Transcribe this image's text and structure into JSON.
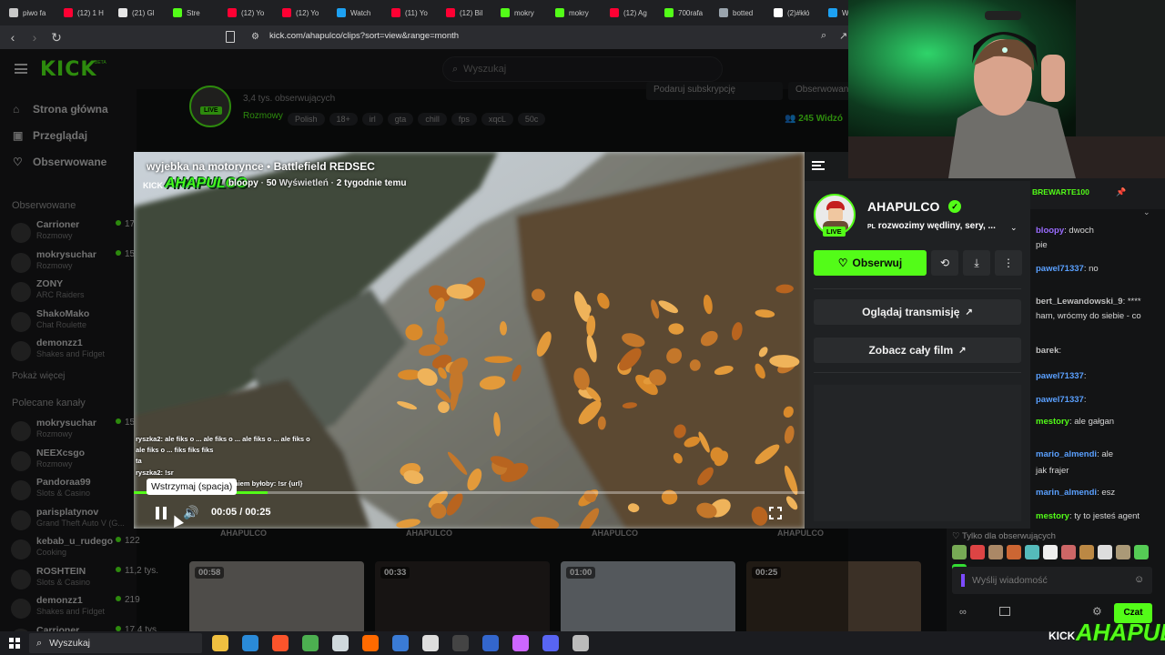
{
  "browser": {
    "tabs": [
      {
        "label": "piwo fa",
        "color": "#c9c9c9"
      },
      {
        "label": "(12) 1 H",
        "color": "#ff0033"
      },
      {
        "label": "(21) Gl",
        "color": "#e6e6e6"
      },
      {
        "label": "Stre",
        "color": "#53fc18"
      },
      {
        "label": "(12) Yo",
        "color": "#ff0033"
      },
      {
        "label": "(12) Yo",
        "color": "#ff0033"
      },
      {
        "label": "Watch",
        "color": "#1da1f2"
      },
      {
        "label": "(11) Yo",
        "color": "#ff0033"
      },
      {
        "label": "(12) Bil",
        "color": "#ff0033"
      },
      {
        "label": "mokry",
        "color": "#53fc18"
      },
      {
        "label": "mokry",
        "color": "#53fc18"
      },
      {
        "label": "(12) Ag",
        "color": "#ff0033"
      },
      {
        "label": "700rafa",
        "color": "#53fc18"
      },
      {
        "label": "botted",
        "color": "#9aa4ad"
      },
      {
        "label": "(2)#kłó",
        "color": "#ffffff"
      },
      {
        "label": "W",
        "color": "#1da1f2"
      }
    ],
    "url": "kick.com/ahapulco/clips?sort=view&range=month"
  },
  "kick": {
    "logo": "KICK",
    "logo_badge": "BETA",
    "search_placeholder": "Wyszukaj",
    "nav": [
      {
        "label": "Strona główna",
        "icon": "home-icon"
      },
      {
        "label": "Przeglądaj",
        "icon": "browse-icon"
      },
      {
        "label": "Obserwowane",
        "icon": "heart-icon"
      }
    ],
    "followed_header": "Obserwowane",
    "followed": [
      {
        "name": "Carrioner",
        "category": "Rozmowy",
        "viewers": "17,"
      },
      {
        "name": "mokrysuchar",
        "category": "Rozmowy",
        "viewers": "15,"
      },
      {
        "name": "ZONY",
        "category": "ARC Raiders",
        "viewers": ""
      },
      {
        "name": "ShakoMako",
        "category": "Chat Roulette",
        "viewers": ""
      },
      {
        "name": "demonzz1",
        "category": "Shakes and Fidget",
        "viewers": ""
      }
    ],
    "show_more": "Pokaż więcej",
    "recommended_header": "Polecane kanały",
    "recommended": [
      {
        "name": "mokrysuchar",
        "category": "Rozmowy",
        "viewers": "15,"
      },
      {
        "name": "NEEXcsgo",
        "category": "Rozmowy",
        "viewers": ""
      },
      {
        "name": "Pandoraa99",
        "category": "Slots & Casino",
        "viewers": ""
      },
      {
        "name": "parisplatynov",
        "category": "Grand Theft Auto V (G...",
        "viewers": ""
      },
      {
        "name": "kebab_u_rudego",
        "category": "Cooking",
        "viewers": "122"
      },
      {
        "name": "ROSHTEIN",
        "category": "Slots & Casino",
        "viewers": "11,2 tys."
      },
      {
        "name": "demonzz1",
        "category": "Shakes and Fidget",
        "viewers": "219"
      },
      {
        "name": "Carrioner",
        "category": "",
        "viewers": "17,4 tys."
      }
    ],
    "channel_header": {
      "followers": "3,4 tys. obserwujących",
      "category": "Rozmowy",
      "tags": [
        "Polish",
        "18+",
        "irl",
        "gta",
        "chill",
        "fps",
        "xqcL",
        "50c"
      ],
      "live": "LIVE",
      "viewers": "245 Widzó",
      "btn1": "Podaruj subskrypcję",
      "btn2": "Obserwowane"
    },
    "clip_channels": [
      "AHAPULCO",
      "AHAPULCO",
      "AHAPULCO",
      "AHAPULCO"
    ],
    "thumbnails": [
      {
        "duration": "00:58",
        "color": "#8e8a86"
      },
      {
        "duration": "00:33",
        "color": "#2a2623"
      },
      {
        "duration": "01:00",
        "color": "#9aa1a8"
      },
      {
        "duration": "00:25",
        "color": "#3b3026"
      }
    ]
  },
  "clip": {
    "title": "wyjebka na motorynce • Battlefield REDSEC",
    "watermark": "AHAPULCO",
    "kick_small": "KICK",
    "author": "bloopy",
    "views_count": "50",
    "views_label": "Wyświetleń",
    "age": "2 tygodnie temu",
    "time": "00:05 / 00:25",
    "tooltip": "Wstrzymaj (spacja)",
    "progress": 0.2,
    "overlay_chat": [
      "ryszka2: ale fiks o ... ale fiks o ... ale fiks o ... ale fiks o",
      "ale fiks o ... fiks fiks fiks",
      "ta",
      "ryszka2: !sr",
      "niem byłoby: !sr {url}"
    ]
  },
  "panel": {
    "channel": "AHAPULCO",
    "verified_icon": "verified-icon",
    "live": "LIVE",
    "lang": "PL",
    "stream_title": "rozwozimy wędliny, sery, ...",
    "follow": "Obserwuj",
    "watch_stream": "Oglądaj transmisję",
    "see_full": "Zobacz cały film"
  },
  "chat": {
    "pinned": "BREWARTE100",
    "lines": [
      {
        "user": "bloopy",
        "text": ": dwoch",
        "color": "#9a6cff"
      },
      {
        "user": "",
        "text": "pie",
        "color": "#d6d6d6"
      },
      {
        "user": "pawel71337",
        "text": ": no",
        "color": "#5aa0ff"
      },
      {
        "user": "bert_Lewandowski_9",
        "text": ": ****",
        "color": "#c0c0c0"
      },
      {
        "user": "",
        "text": "ham, wrócmy do siebie - co",
        "color": "#d6d6d6"
      },
      {
        "user": "barek",
        "text": ":",
        "color": "#c0c0c0"
      },
      {
        "user": "pawel71337",
        "text": ":",
        "color": "#5aa0ff"
      },
      {
        "user": "pawel71337",
        "text": ":",
        "color": "#5aa0ff"
      },
      {
        "user": "mestory",
        "text": ": ale gałgan",
        "color": "#53fc18"
      },
      {
        "user": "mario_almendi",
        "text": ": ale",
        "color": "#5aa0ff"
      },
      {
        "user": "",
        "text": "jak frajer",
        "color": "#d6d6d6"
      },
      {
        "user": "marin_almendi",
        "text": ": esz",
        "color": "#5aa0ff"
      },
      {
        "user": "mestory",
        "text": ": ty to jesteś agent",
        "color": "#53fc18"
      }
    ],
    "followers_only": "Tylko dla obserwujących",
    "input_placeholder": "Wyślij wiadomość",
    "send": "Czat",
    "stream_logo": "AHAPULCO",
    "kick_small": "KICK"
  },
  "taskbar": {
    "search": "Wyszukaj"
  }
}
